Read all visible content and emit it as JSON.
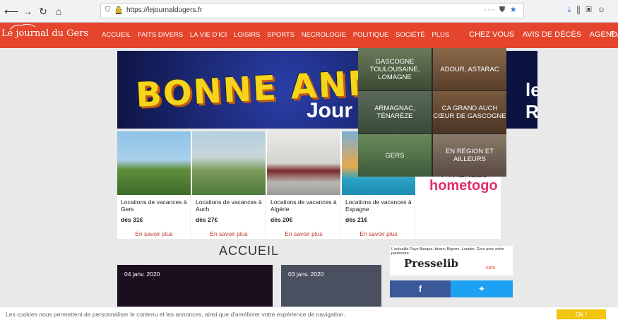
{
  "browser": {
    "url": "https://lejournaldugers.fr",
    "menu_dots": "···"
  },
  "header": {
    "logo": "Le journal du Gers",
    "nav_items": [
      "ACCUEIL",
      "FAITS DIVERS",
      "LA VIE D'ICI",
      "LOISIRS",
      "SPORTS",
      "NECROLOGIE",
      "POLITIQUE",
      "SOCIÉTÉ",
      "PLUS"
    ],
    "nav_right": [
      "CHEZ VOUS",
      "AVIS DE DÉCÈS",
      "AGENDA"
    ]
  },
  "banner": {
    "text": "BONNE ANNÉE 20",
    "sub": "Jour",
    "right": "le\nRS"
  },
  "dropdown": {
    "regions": [
      "GASCOGNE TOULOUSAINE, LOMAGNE",
      "ADOUR, ASTARAC",
      "ARMAGNAC, TÉNARÈZE",
      "CA GRAND AUCH CŒUR DE GASCOGNE",
      "GERS",
      "EN RÉGION ET AILLEURS"
    ]
  },
  "ad_cards": [
    {
      "title": "Locations de vacances à Gers",
      "price": "dès 31€",
      "link": "En savoir plus"
    },
    {
      "title": "Locations de vacances à Auch",
      "price": "dès 27€",
      "link": "En savoir plus"
    },
    {
      "title": "Locations de vacances à Algérie",
      "price": "dès 20€",
      "link": "En savoir plus"
    },
    {
      "title": "Locations de vacances à Espagne",
      "price": "dès 21€",
      "link": "En savoir plus"
    }
  ],
  "ad_brand": "hometogo",
  "ad_overlay_text": "PYRÉNÉES",
  "main": {
    "section_title": "ACCUEIL",
    "articles": [
      {
        "date": "04 janv. 2020"
      },
      {
        "date": "03 janv. 2020"
      }
    ]
  },
  "sidebar": {
    "presse_caption": "L'actualité Pays Basque, béarn, Bigorre, Landes, Gers avec notre partenaire",
    "presse_logo": "Presselib",
    "presse_com": ".com",
    "facebook": "f",
    "twitter": "🐦"
  },
  "cookie": {
    "text": "Les cookies nous permettent de personnaliser le contenu et les annonces, ainsi que d'améliorer votre expérience de navigation.",
    "ok": "Ok !"
  },
  "colors": {
    "header_red": "#e4452c",
    "cookie_ok": "#f1c40f",
    "facebook": "#3b5998",
    "twitter": "#1da1f2"
  }
}
